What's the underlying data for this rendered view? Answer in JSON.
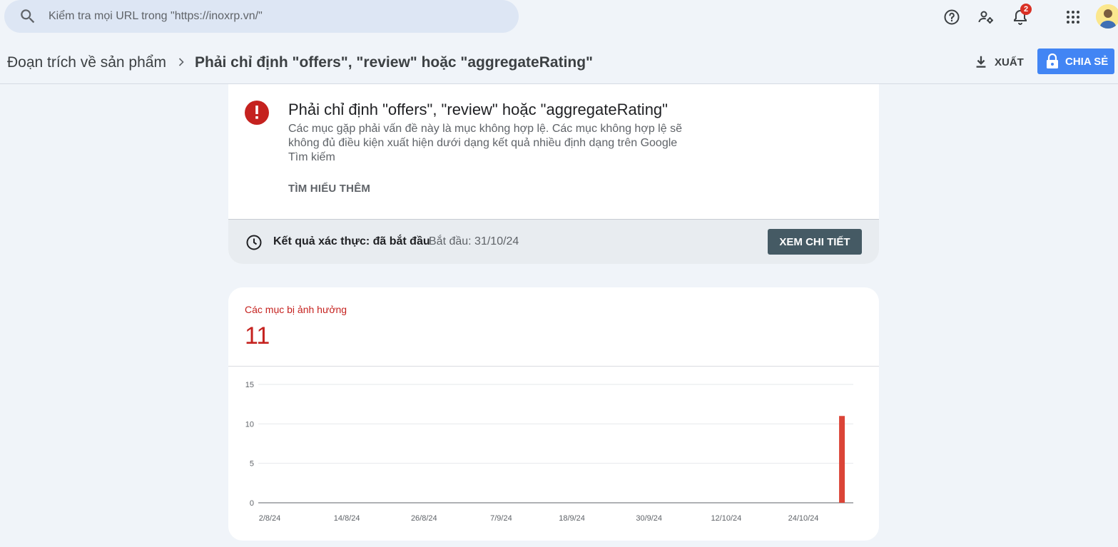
{
  "search": {
    "placeholder": "Kiểm tra mọi URL trong \"https://inoxrp.vn/\""
  },
  "topbar": {
    "notification_count": "2"
  },
  "header": {
    "breadcrumb_parent": "Đoạn trích về sản phẩm",
    "breadcrumb_current": "Phải chỉ định \"offers\", \"review\" hoặc \"aggregateRating\"",
    "export_label": "XUẤT",
    "share_label": "CHIA SẺ"
  },
  "issue": {
    "title": "Phải chỉ định \"offers\", \"review\" hoặc \"aggregateRating\"",
    "description": "Các mục gặp phải vấn đề này là mục không hợp lệ. Các mục không hợp lệ sẽ không đủ điều kiện xuất hiện dưới dạng kết quả nhiều định dạng trên Google Tìm kiếm",
    "learn_more": "TÌM HIỂU THÊM",
    "validation_label": "Kết quả xác thực: đã bắt đầu",
    "validation_start": "Bắt đầu: 31/10/24",
    "details_button": "XEM CHI TIẾT"
  },
  "metric": {
    "label": "Các mục bị ảnh hưởng",
    "value": "11"
  },
  "colors": {
    "accent_red": "#c5221f",
    "bar_red": "#db4437",
    "share_blue": "#4285f4",
    "details_gray": "#455a64"
  },
  "chart_data": {
    "type": "bar",
    "title": "",
    "xlabel": "",
    "ylabel": "",
    "ylim": [
      0,
      15
    ],
    "yticks": [
      0,
      5,
      10,
      15
    ],
    "x_tick_labels": [
      "2/8/24",
      "14/8/24",
      "26/8/24",
      "7/9/24",
      "18/9/24",
      "30/9/24",
      "12/10/24",
      "24/10/24"
    ],
    "x_start": "2/8/24",
    "x_end": "30/10/24",
    "bars": [
      {
        "x": "30/10/24",
        "value": 11
      }
    ],
    "grid": true,
    "legend": "none"
  }
}
